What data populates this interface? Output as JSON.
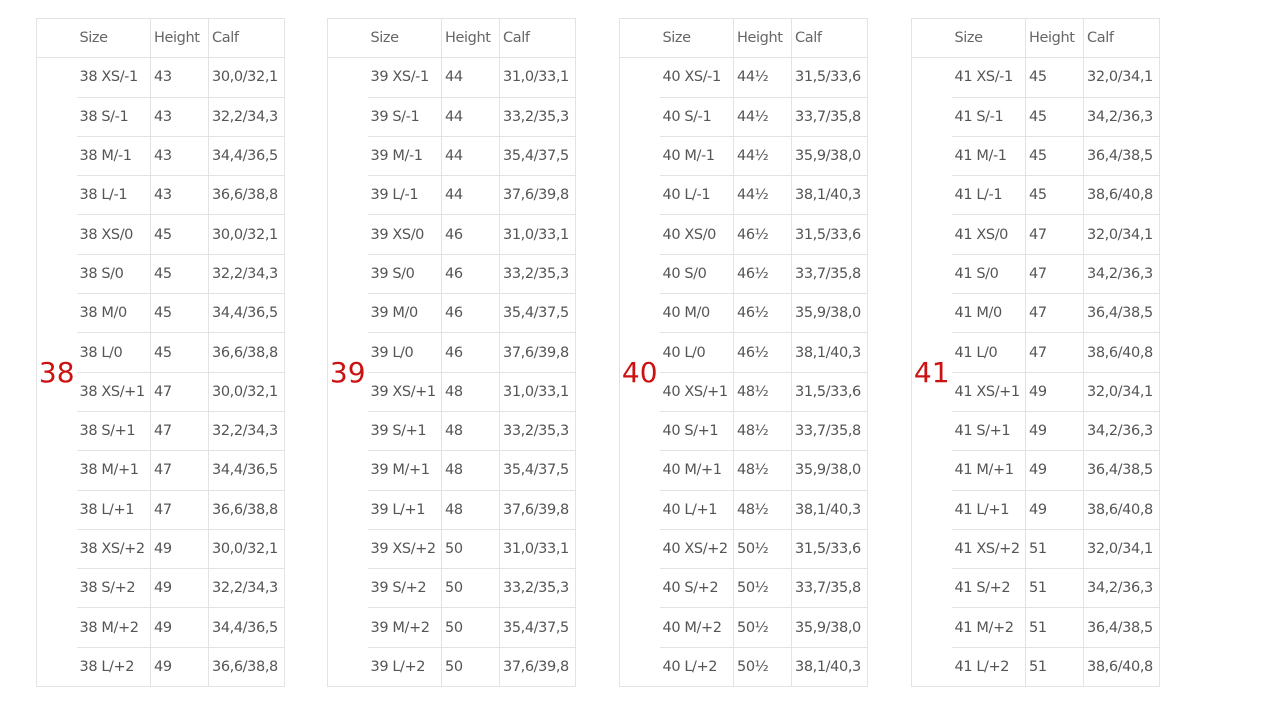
{
  "headers": [
    "Size",
    "Height",
    "Calf"
  ],
  "accent_color": "#cc1111",
  "groups": [
    {
      "label": "38",
      "rows": [
        [
          "38 XS/-1",
          "43",
          "30,0/32,1"
        ],
        [
          "38 S/-1",
          "43",
          "32,2/34,3"
        ],
        [
          "38 M/-1",
          "43",
          "34,4/36,5"
        ],
        [
          "38 L/-1",
          "43",
          "36,6/38,8"
        ],
        [
          "38 XS/0",
          "45",
          "30,0/32,1"
        ],
        [
          "38 S/0",
          "45",
          "32,2/34,3"
        ],
        [
          "38 M/0",
          "45",
          "34,4/36,5"
        ],
        [
          "38 L/0",
          "45",
          "36,6/38,8"
        ],
        [
          "38 XS/+1",
          "47",
          "30,0/32,1"
        ],
        [
          "38 S/+1",
          "47",
          "32,2/34,3"
        ],
        [
          "38 M/+1",
          "47",
          "34,4/36,5"
        ],
        [
          "38 L/+1",
          "47",
          "36,6/38,8"
        ],
        [
          "38 XS/+2",
          "49",
          "30,0/32,1"
        ],
        [
          "38 S/+2",
          "49",
          "32,2/34,3"
        ],
        [
          "38 M/+2",
          "49",
          "34,4/36,5"
        ],
        [
          "38 L/+2",
          "49",
          "36,6/38,8"
        ]
      ]
    },
    {
      "label": "39",
      "rows": [
        [
          "39 XS/-1",
          "44",
          "31,0/33,1"
        ],
        [
          "39 S/-1",
          "44",
          "33,2/35,3"
        ],
        [
          "39 M/-1",
          "44",
          "35,4/37,5"
        ],
        [
          "39 L/-1",
          "44",
          "37,6/39,8"
        ],
        [
          "39 XS/0",
          "46",
          "31,0/33,1"
        ],
        [
          "39 S/0",
          "46",
          "33,2/35,3"
        ],
        [
          "39 M/0",
          "46",
          "35,4/37,5"
        ],
        [
          "39 L/0",
          "46",
          "37,6/39,8"
        ],
        [
          "39 XS/+1",
          "48",
          "31,0/33,1"
        ],
        [
          "39 S/+1",
          "48",
          "33,2/35,3"
        ],
        [
          "39 M/+1",
          "48",
          "35,4/37,5"
        ],
        [
          "39 L/+1",
          "48",
          "37,6/39,8"
        ],
        [
          "39 XS/+2",
          "50",
          "31,0/33,1"
        ],
        [
          "39 S/+2",
          "50",
          "33,2/35,3"
        ],
        [
          "39 M/+2",
          "50",
          "35,4/37,5"
        ],
        [
          "39 L/+2",
          "50",
          "37,6/39,8"
        ]
      ]
    },
    {
      "label": "40",
      "rows": [
        [
          "40 XS/-1",
          "44½",
          "31,5/33,6"
        ],
        [
          "40 S/-1",
          "44½",
          "33,7/35,8"
        ],
        [
          "40 M/-1",
          "44½",
          "35,9/38,0"
        ],
        [
          "40 L/-1",
          "44½",
          "38,1/40,3"
        ],
        [
          "40 XS/0",
          "46½",
          "31,5/33,6"
        ],
        [
          "40 S/0",
          "46½",
          "33,7/35,8"
        ],
        [
          "40 M/0",
          "46½",
          "35,9/38,0"
        ],
        [
          "40 L/0",
          "46½",
          "38,1/40,3"
        ],
        [
          "40 XS/+1",
          "48½",
          "31,5/33,6"
        ],
        [
          "40 S/+1",
          "48½",
          "33,7/35,8"
        ],
        [
          "40 M/+1",
          "48½",
          "35,9/38,0"
        ],
        [
          "40 L/+1",
          "48½",
          "38,1/40,3"
        ],
        [
          "40 XS/+2",
          "50½",
          "31,5/33,6"
        ],
        [
          "40 S/+2",
          "50½",
          "33,7/35,8"
        ],
        [
          "40 M/+2",
          "50½",
          "35,9/38,0"
        ],
        [
          "40 L/+2",
          "50½",
          "38,1/40,3"
        ]
      ]
    },
    {
      "label": "41",
      "rows": [
        [
          "41 XS/-1",
          "45",
          "32,0/34,1"
        ],
        [
          "41 S/-1",
          "45",
          "34,2/36,3"
        ],
        [
          "41 M/-1",
          "45",
          "36,4/38,5"
        ],
        [
          "41 L/-1",
          "45",
          "38,6/40,8"
        ],
        [
          "41 XS/0",
          "47",
          "32,0/34,1"
        ],
        [
          "41 S/0",
          "47",
          "34,2/36,3"
        ],
        [
          "41 M/0",
          "47",
          "36,4/38,5"
        ],
        [
          "41 L/0",
          "47",
          "38,6/40,8"
        ],
        [
          "41 XS/+1",
          "49",
          "32,0/34,1"
        ],
        [
          "41 S/+1",
          "49",
          "34,2/36,3"
        ],
        [
          "41 M/+1",
          "49",
          "36,4/38,5"
        ],
        [
          "41 L/+1",
          "49",
          "38,6/40,8"
        ],
        [
          "41 XS/+2",
          "51",
          "32,0/34,1"
        ],
        [
          "41 S/+2",
          "51",
          "34,2/36,3"
        ],
        [
          "41 M/+2",
          "51",
          "36,4/38,5"
        ],
        [
          "41 L/+2",
          "51",
          "38,6/40,8"
        ]
      ]
    }
  ]
}
